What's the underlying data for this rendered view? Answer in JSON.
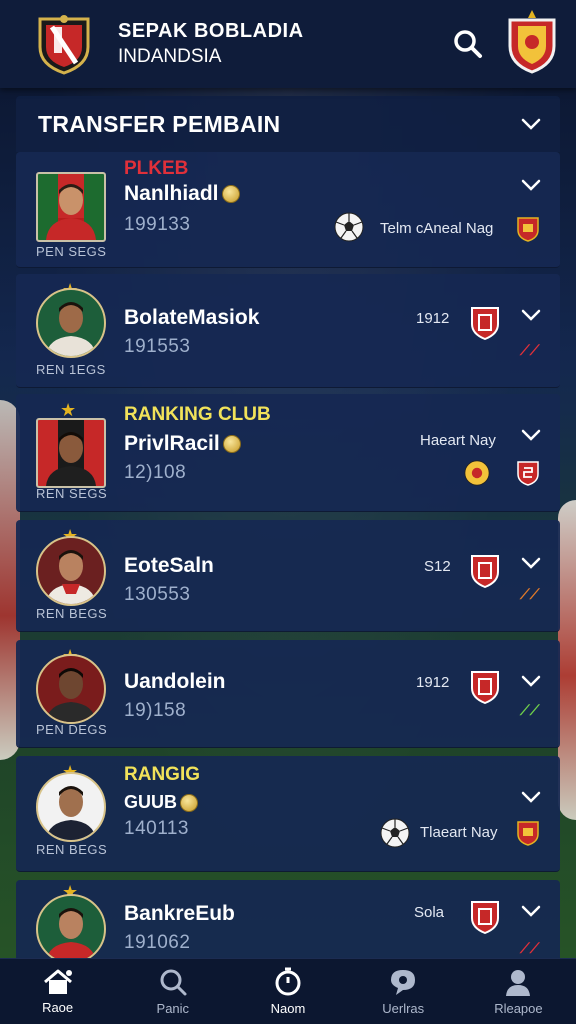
{
  "header": {
    "title_line1": "SEPAK BOBLADIA",
    "title_line2": "INDANDSIA"
  },
  "section": {
    "title": "TRANSFER PEMBAIN"
  },
  "players": [
    {
      "tag": "PLKEB",
      "tag_color": "#e0303a",
      "name": "Nanlhiadl",
      "has_coin": true,
      "number": "199133",
      "position": "PEN SEGS",
      "right_text": "Telm cAneal Nag",
      "right_num": "",
      "has_ball": true
    },
    {
      "tag": "",
      "name": "BolateMasiok",
      "has_coin": false,
      "number": "191553",
      "position": "REN 1EGS",
      "right_text": "",
      "right_num": "1912",
      "has_ball": false
    },
    {
      "tag": "RANKING CLUB",
      "tag_color": "#f1e25a",
      "name": "PrivlRacil",
      "has_coin": true,
      "number": "12)108",
      "position": "REN SEGS",
      "right_text": "Haeart Nay",
      "right_num": "",
      "has_ball": true
    },
    {
      "tag": "",
      "name": "EoteSaln",
      "has_coin": false,
      "number": "130553",
      "position": "REN BEGS",
      "right_text": "",
      "right_num": "S12",
      "has_ball": false
    },
    {
      "tag": "",
      "name": "Uandolein",
      "has_coin": false,
      "number": "19)158",
      "position": "PEN DEGS",
      "right_text": "",
      "right_num": "1912",
      "has_ball": false
    },
    {
      "tag": "RANGIG",
      "tag_color": "#f1e25a",
      "name": "GUUB",
      "has_coin": true,
      "number": "140113",
      "position": "REN BEGS",
      "right_text": "Tlaeart Nay",
      "right_num": "",
      "has_ball": true
    },
    {
      "tag": "",
      "name": "BankreEub",
      "has_coin": false,
      "number": "191062",
      "position": "",
      "right_text": "",
      "right_num": "Sola",
      "has_ball": false
    }
  ],
  "nav": [
    {
      "label": "Raoe",
      "icon": "home-icon",
      "active": true
    },
    {
      "label": "Panic",
      "icon": "search-icon",
      "active": false
    },
    {
      "label": "Naom",
      "icon": "timer-icon",
      "active": true
    },
    {
      "label": "Uerlras",
      "icon": "chat-icon",
      "active": false
    },
    {
      "label": "Rleapoe",
      "icon": "profile-icon",
      "active": false
    }
  ],
  "colors": {
    "header_bg": "#0f1c3a",
    "card_bg": "#162852",
    "accent_red": "#e0303a",
    "accent_yellow": "#f1e25a",
    "gold": "#e3b321"
  }
}
